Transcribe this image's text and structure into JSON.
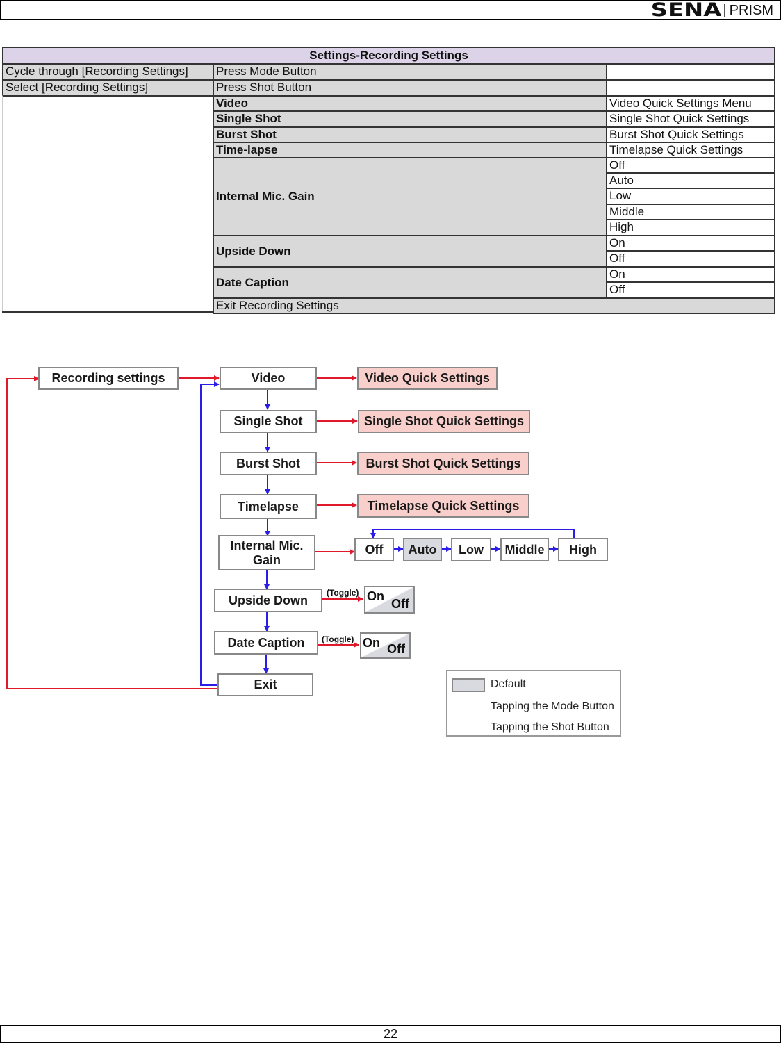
{
  "header": {
    "brand": "SENA",
    "separator": "|",
    "product": "PRISM"
  },
  "table": {
    "title": "Settings-Recording Settings",
    "rows": [
      {
        "action": "Cycle through [Recording Settings]",
        "button": "Press Mode Button"
      },
      {
        "action": "Select [Recording Settings]",
        "button": "Press Shot Button"
      }
    ],
    "items": [
      {
        "label": "Video",
        "options": [
          "Video Quick Settings Menu"
        ]
      },
      {
        "label": "Single Shot",
        "options": [
          "Single Shot Quick Settings"
        ]
      },
      {
        "label": "Burst Shot",
        "options": [
          "Burst Shot Quick Settings"
        ]
      },
      {
        "label": "Time-lapse",
        "options": [
          "Timelapse Quick Settings"
        ]
      },
      {
        "label": "Internal Mic. Gain",
        "options": [
          "Off",
          "Auto",
          "Low",
          "Middle",
          "High"
        ]
      },
      {
        "label": "Upside Down",
        "options": [
          "On",
          "Off"
        ]
      },
      {
        "label": "Date Caption",
        "options": [
          "On",
          "Off"
        ]
      }
    ],
    "exit": "Exit Recording Settings"
  },
  "flowchart": {
    "start": "Recording settings",
    "menu": [
      "Video",
      "Single Shot",
      "Burst Shot",
      "Timelapse",
      "Internal Mic. Gain",
      "Upside Down",
      "Date Caption",
      "Exit"
    ],
    "quick_settings": [
      "Video Quick Settings",
      "Single Shot Quick Settings",
      "Burst Shot Quick Settings",
      "Timelapse Quick Settings"
    ],
    "mic_gain_options": [
      "Off",
      "Auto",
      "Low",
      "Middle",
      "High"
    ],
    "mic_gain_default": "Auto",
    "toggle_label": "(Toggle)",
    "toggle_on": "On",
    "toggle_off": "Off",
    "colors": {
      "mode_arrow": "#2a1ee6",
      "shot_arrow": "#e0192a",
      "default_fill": "#d9dadf",
      "quick_fill": "#f9cfcc"
    }
  },
  "legend": {
    "default": "Default",
    "mode": "Tapping the Mode Button",
    "shot": "Tapping the Shot Button"
  },
  "footer": {
    "page_number": "22"
  }
}
